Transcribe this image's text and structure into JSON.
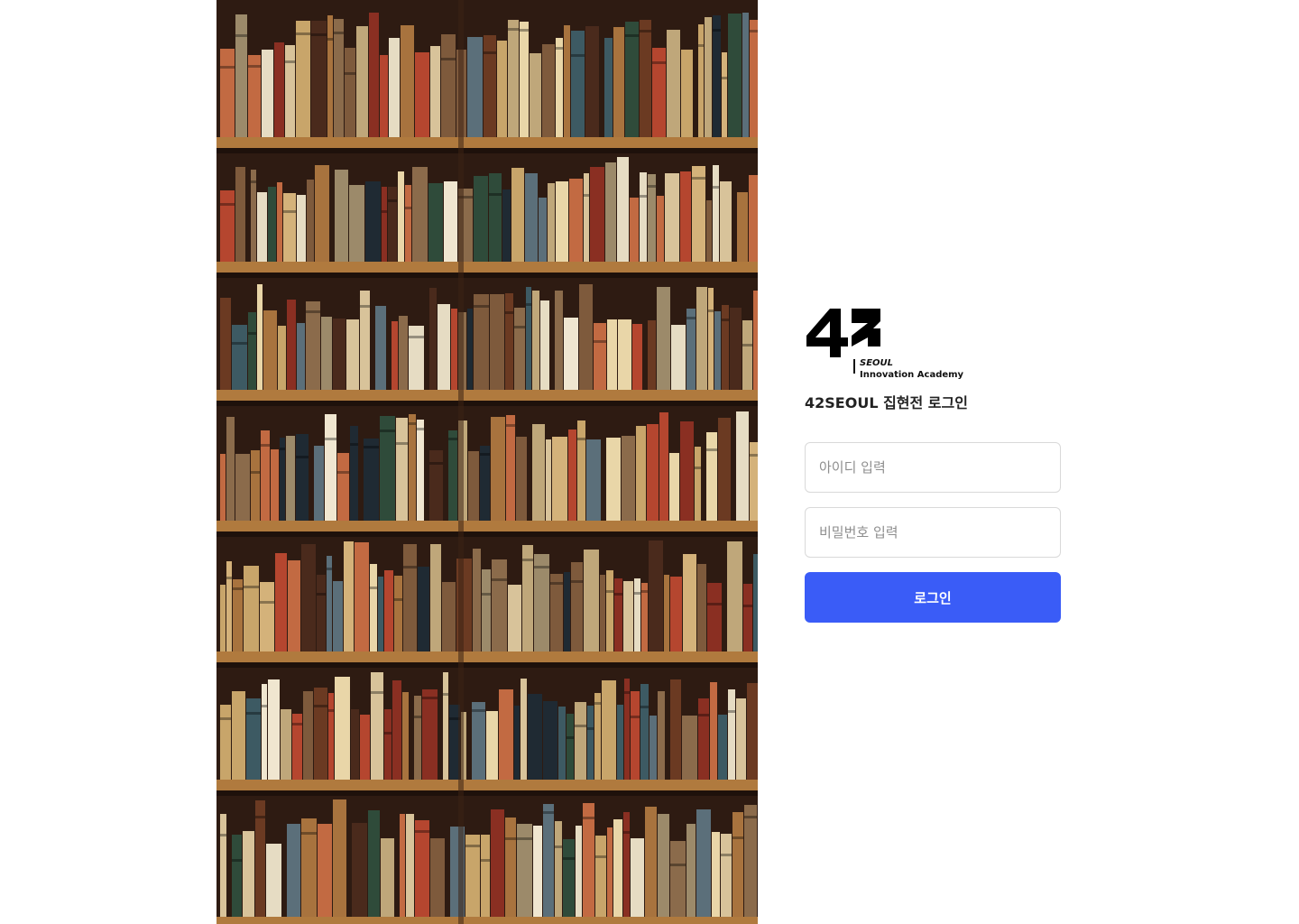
{
  "hero_image": {
    "alt": "bookshelf-photo"
  },
  "brand": {
    "logo_mark": "42",
    "logo_line1": "SEOUL",
    "logo_line2": "Innovation Academy"
  },
  "login": {
    "title": "42SEOUL 집현전 로그인",
    "id_placeholder": "아이디 입력",
    "pw_placeholder": "비밀번호 입력",
    "submit_label": "로그인"
  },
  "colors": {
    "primary": "#3a5cf7",
    "border": "#d9d9d9",
    "placeholder": "#8e8e8e"
  }
}
